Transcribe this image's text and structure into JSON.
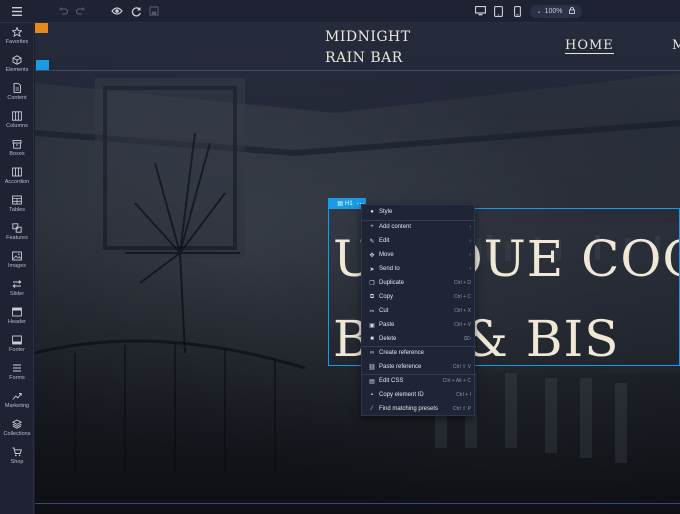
{
  "toolbar": {
    "menu_icon": "hamburger-icon",
    "undo_icon": "undo-icon",
    "redo_icon": "redo-icon",
    "preview_icon": "eye-icon",
    "sync_icon": "refresh-icon",
    "save_icon": "save-icon",
    "devices": [
      "desktop-icon",
      "tablet-icon",
      "mobile-icon"
    ],
    "zoom_label": "100%"
  },
  "sidebar": {
    "items": [
      {
        "label": "Favorites",
        "icon": "star-icon"
      },
      {
        "label": "Elements",
        "icon": "cube-icon"
      },
      {
        "label": "Content",
        "icon": "document-icon"
      },
      {
        "label": "Columns",
        "icon": "columns-icon"
      },
      {
        "label": "Boxes",
        "icon": "box-icon"
      },
      {
        "label": "Accordion",
        "icon": "accordion-icon"
      },
      {
        "label": "Tables",
        "icon": "table-icon"
      },
      {
        "label": "Features",
        "icon": "features-icon"
      },
      {
        "label": "Images",
        "icon": "image-icon"
      },
      {
        "label": "Slider",
        "icon": "slider-icon"
      },
      {
        "label": "Header",
        "icon": "header-icon"
      },
      {
        "label": "Footer",
        "icon": "footer-icon"
      },
      {
        "label": "Forms",
        "icon": "forms-icon"
      },
      {
        "label": "Marketing",
        "icon": "chart-icon"
      },
      {
        "label": "Collections",
        "icon": "layers-icon"
      },
      {
        "label": "Shop",
        "icon": "cart-icon"
      }
    ]
  },
  "site": {
    "logo_line1": "MIDNIGHT",
    "logo_line2": "RAIN BAR",
    "nav_home": "HOME",
    "nav_more": "M",
    "headline_line1": "UNIQUE COC",
    "headline_line2": "BAR & BIS"
  },
  "selection": {
    "tag_label": "H1"
  },
  "context_menu": {
    "items": [
      {
        "label": "Style",
        "icon": "palette-icon",
        "shortcut": ""
      },
      {
        "label": "Add content",
        "icon": "plus-icon",
        "shortcut": "›"
      },
      {
        "label": "Edit",
        "icon": "pencil-icon",
        "shortcut": "›"
      },
      {
        "label": "Move",
        "icon": "move-icon",
        "shortcut": "›"
      },
      {
        "label": "Send to",
        "icon": "send-icon",
        "shortcut": "›"
      },
      {
        "label": "Duplicate",
        "icon": "duplicate-icon",
        "shortcut": "Ctrl + D"
      },
      {
        "label": "Copy",
        "icon": "copy-icon",
        "shortcut": "Ctrl + C"
      },
      {
        "label": "Cut",
        "icon": "scissors-icon",
        "shortcut": "Ctrl + X"
      },
      {
        "label": "Paste",
        "icon": "paste-icon",
        "shortcut": "Ctrl + V"
      },
      {
        "label": "Delete",
        "icon": "trash-icon",
        "shortcut": "⌦"
      },
      {
        "label": "Create reference",
        "icon": "link-icon",
        "shortcut": ""
      },
      {
        "label": "Paste reference",
        "icon": "paste-link-icon",
        "shortcut": "Ctrl ⇧ V"
      },
      {
        "label": "Edit CSS",
        "icon": "css-icon",
        "shortcut": "Ctrl + Alt + C"
      },
      {
        "label": "Copy element ID",
        "icon": "id-icon",
        "shortcut": "Ctrl + I"
      },
      {
        "label": "Find matching presets",
        "icon": "wand-icon",
        "shortcut": "Ctrl ⇧ P"
      }
    ]
  },
  "colors": {
    "accent": "#1a9be8",
    "warning": "#e78a1e",
    "chrome": "#1e2233"
  }
}
